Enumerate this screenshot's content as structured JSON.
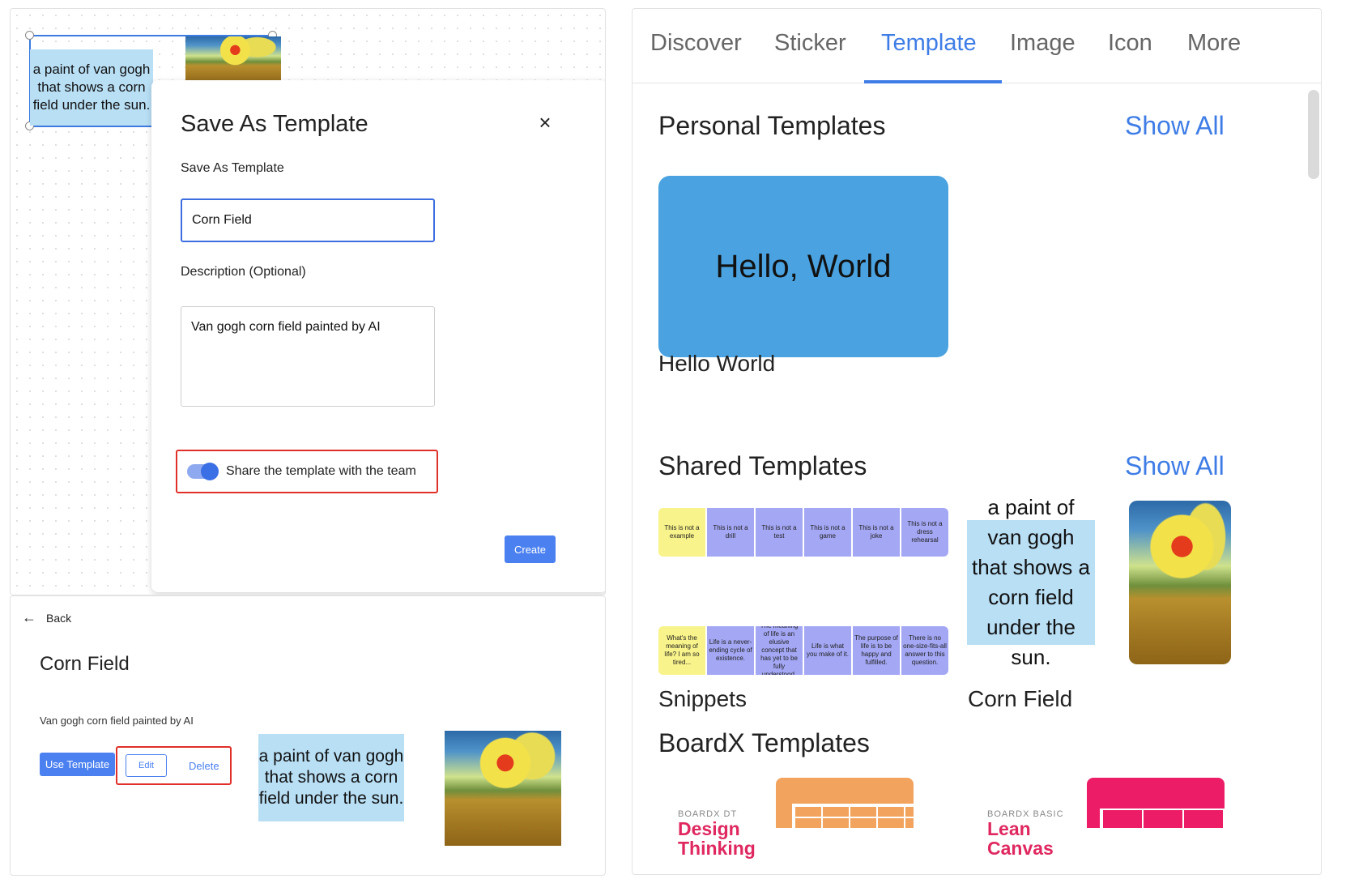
{
  "canvas": {
    "sticky_text": "a paint of van gogh that shows a corn field under the sun."
  },
  "modal": {
    "title": "Save As Template",
    "close_icon": "×",
    "name_label": "Save As Template",
    "name_value": "Corn Field",
    "description_label": "Description (Optional)",
    "description_value": "Van gogh corn field painted by AI",
    "share_label": "Share the template with the team",
    "share_enabled": true,
    "create_label": "Create"
  },
  "detail": {
    "back_label": "Back",
    "back_icon": "←",
    "title": "Corn Field",
    "description": "Van gogh corn field painted by AI",
    "use_template_label": "Use Template",
    "edit_label": "Edit",
    "delete_label": "Delete",
    "sticky_text": "a paint of van gogh that shows a corn field under the sun."
  },
  "tabs": [
    {
      "label": "Discover",
      "active": false
    },
    {
      "label": "Sticker",
      "active": false
    },
    {
      "label": "Template",
      "active": true
    },
    {
      "label": "Image",
      "active": false
    },
    {
      "label": "Icon",
      "active": false
    },
    {
      "label": "More",
      "active": false
    }
  ],
  "personal": {
    "title": "Personal Templates",
    "show_all": "Show All",
    "card_text": "Hello, World",
    "card_caption": "Hello World"
  },
  "shared": {
    "title": "Shared Templates",
    "show_all": "Show All",
    "snippets_row1": [
      "This is not a example",
      "This is not a drill",
      "This is not a test",
      "This is not a game",
      "This is not a joke",
      "This is not a dress rehearsal"
    ],
    "snippets_row2": [
      "What's the meaning of life? I am so tired...",
      "Life is a never-ending cycle of existence.",
      "The meaning of life is an elusive concept that has yet to be fully understood.",
      "Life is what you make of it.",
      "The purpose of life is to be happy and fulfilled.",
      "There is no one-size-fits-all answer to this question."
    ],
    "snippets_caption": "Snippets",
    "corn_sticky_text": "a paint of van gogh that shows a corn field under the sun.",
    "corn_caption": "Corn Field"
  },
  "boardx": {
    "title": "BoardX Templates",
    "cards": [
      {
        "sub": "BOARDX DT",
        "name": "Design Thinking"
      },
      {
        "sub": "BOARDX BASIC",
        "name": "Lean Canvas"
      }
    ]
  },
  "colors": {
    "accent": "#3f7de6",
    "highlight_border": "#e0302a",
    "sticky": "#b9dff5",
    "hello_card": "#4aa3e0",
    "snippet_blue": "#a3a7f4",
    "snippet_yellow": "#f8f38a"
  }
}
